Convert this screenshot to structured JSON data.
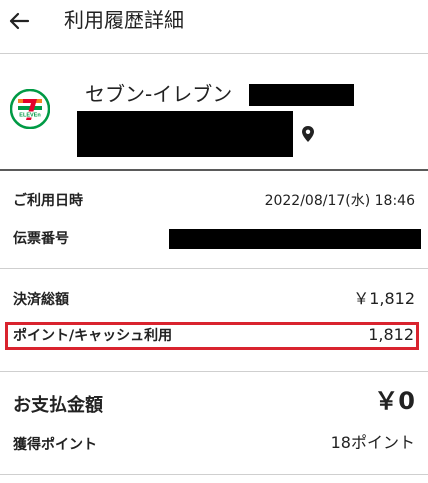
{
  "header": {
    "title": "利用履歴詳細",
    "back_icon": "arrow-left-icon"
  },
  "store": {
    "name": "セブン-イレブン",
    "logo_icon": "seven-eleven-logo",
    "logo_text": "ELEVEn",
    "location_icon": "map-pin-icon"
  },
  "details": {
    "date_label": "ご利用日時",
    "date_value": "2022/08/17(水) 18:46",
    "slip_label": "伝票番号"
  },
  "payment": {
    "total_label": "決済総額",
    "total_value": "￥1,812",
    "points_label": "ポイント/キャッシュ利用",
    "points_value": "1,812",
    "pay_label": "お支払金額",
    "pay_value": "￥0",
    "earned_label": "獲得ポイント",
    "earned_value": "18ポイント"
  },
  "colors": {
    "highlight": "#d9232e",
    "logo_green": "#009a44",
    "logo_orange": "#f58220",
    "logo_red": "#e4002b"
  }
}
